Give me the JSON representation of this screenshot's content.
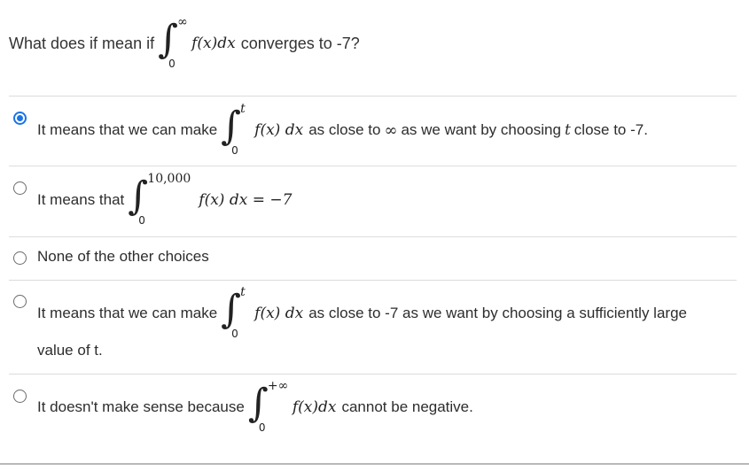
{
  "question": {
    "prefix": "What does if mean if",
    "integral_upper": "∞",
    "integral_lower": "0",
    "integrand": "f(x)dx",
    "suffix": "converges to -7?"
  },
  "choices": [
    {
      "selected": true,
      "pre": "It means that we can make",
      "integral_upper": "t",
      "integral_lower": "0",
      "integrand": "f(x) dx",
      "mid": "as close to",
      "infinity": "∞",
      "mid2": "as we want by choosing",
      "var": "t",
      "post": "close to -7."
    },
    {
      "selected": false,
      "pre": "It means that",
      "integral_upper": "10,000",
      "integral_lower": "0",
      "expr": "f(x) dx = −7"
    },
    {
      "selected": false,
      "text": "None of the other choices"
    },
    {
      "selected": false,
      "pre": "It means that we can make",
      "integral_upper": "t",
      "integral_lower": "0",
      "integrand": "f(x) dx",
      "post": "as close to -7 as we want by choosing a sufficiently large",
      "line2": "value of t."
    },
    {
      "selected": false,
      "pre": "It doesn't make sense because",
      "integral_upper": "+∞",
      "integral_lower": "0",
      "integrand": "f(x)dx",
      "post": "cannot be negative."
    }
  ],
  "colors": {
    "accent": "#1a73e8",
    "divider": "#dcdcdc"
  }
}
